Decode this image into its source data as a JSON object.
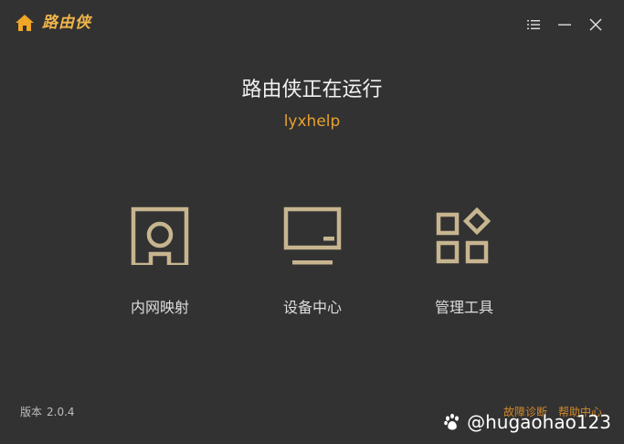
{
  "app": {
    "name": "路由侠",
    "brand_color": "#f0b54a",
    "background": "#323232"
  },
  "window_controls": {
    "menu_icon": "list-menu-icon",
    "minimize_icon": "minimize-icon",
    "close_icon": "close-icon"
  },
  "status": {
    "title": "路由侠正在运行",
    "username": "lyxhelp"
  },
  "tiles": [
    {
      "label": "内网映射",
      "icon": "port-mapping-icon"
    },
    {
      "label": "设备中心",
      "icon": "monitor-icon"
    },
    {
      "label": "管理工具",
      "icon": "apps-grid-icon"
    }
  ],
  "footer": {
    "version_label": "版本",
    "version_value": "2.0.4",
    "diagnose_label": "故障诊断",
    "help_label": "帮助中心"
  },
  "watermark": {
    "text": "@hugaohao123",
    "icon": "paw-icon"
  }
}
